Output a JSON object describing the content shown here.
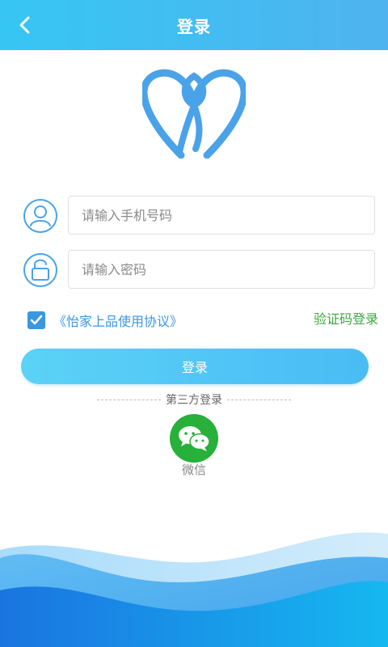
{
  "header": {
    "title": "登录",
    "back_icon": "chevron-left-icon"
  },
  "logo": {
    "icon": "heart-logo-icon",
    "color": "#4aa3e8"
  },
  "form": {
    "phone": {
      "icon": "user-icon",
      "placeholder": "请输入手机号码",
      "value": ""
    },
    "password": {
      "icon": "lock-icon",
      "placeholder": "请输入密码",
      "value": ""
    },
    "agreement": {
      "checked": true,
      "label": "《怡家上品使用协议》"
    },
    "sms_login": "验证码登录",
    "login_button": "登录"
  },
  "third_party": {
    "label": "第三方登录",
    "wechat": {
      "icon": "wechat-icon",
      "label": "微信"
    }
  },
  "colors": {
    "header": "#36c6f4",
    "accent": "#3a97e0",
    "sms_link": "#3fa63f",
    "wechat": "#27b03a"
  }
}
